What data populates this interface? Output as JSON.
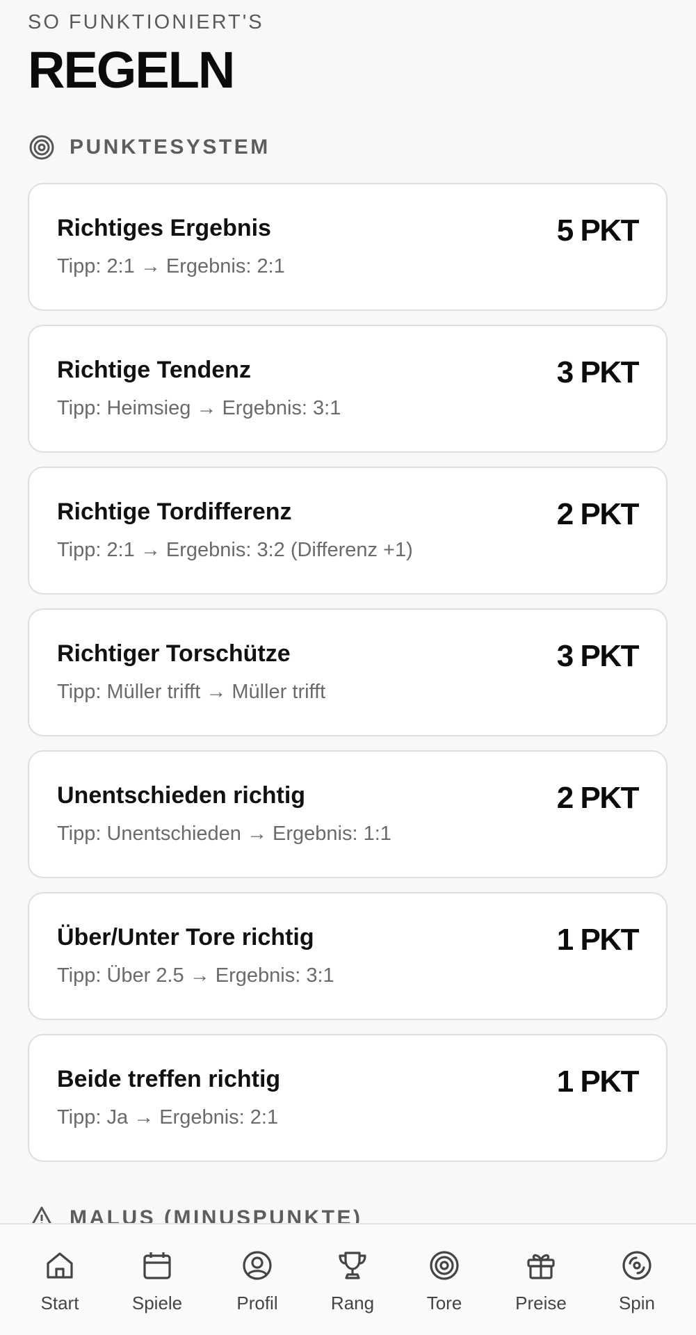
{
  "header": {
    "eyebrow": "SO FUNKTIONIERT'S",
    "title": "REGELN"
  },
  "points_section": {
    "label": "PUNKTESYSTEM",
    "icon": "target-icon",
    "rules": [
      {
        "title": "Richtiges Ergebnis",
        "example": "Tipp: 2:1 → Ergebnis: 2:1",
        "points": "5 PKT"
      },
      {
        "title": "Richtige Tendenz",
        "example": "Tipp: Heimsieg → Ergebnis: 3:1",
        "points": "3 PKT"
      },
      {
        "title": "Richtige Tordifferenz",
        "example": "Tipp: 2:1 → Ergebnis: 3:2 (Differenz +1)",
        "points": "2 PKT"
      },
      {
        "title": "Richtiger Torschütze",
        "example": "Tipp: Müller trifft → Müller trifft",
        "points": "3 PKT"
      },
      {
        "title": "Unentschieden richtig",
        "example": "Tipp: Unentschieden → Ergebnis: 1:1",
        "points": "2 PKT"
      },
      {
        "title": "Über/Unter Tore richtig",
        "example": "Tipp: Über 2.5 → Ergebnis: 3:1",
        "points": "1 PKT"
      },
      {
        "title": "Beide treffen richtig",
        "example": "Tipp: Ja → Ergebnis: 2:1",
        "points": "1 PKT"
      }
    ]
  },
  "malus_section": {
    "label": "MALUS (MINUSPUNKTE)",
    "icon": "warning-icon"
  },
  "bottom_nav": {
    "items": [
      {
        "label": "Start",
        "icon": "home-icon"
      },
      {
        "label": "Spiele",
        "icon": "calendar-icon"
      },
      {
        "label": "Profil",
        "icon": "user-circle-icon"
      },
      {
        "label": "Rang",
        "icon": "trophy-icon"
      },
      {
        "label": "Tore",
        "icon": "target-icon"
      },
      {
        "label": "Preise",
        "icon": "gift-icon"
      },
      {
        "label": "Spin",
        "icon": "spin-wheel-icon"
      }
    ]
  }
}
